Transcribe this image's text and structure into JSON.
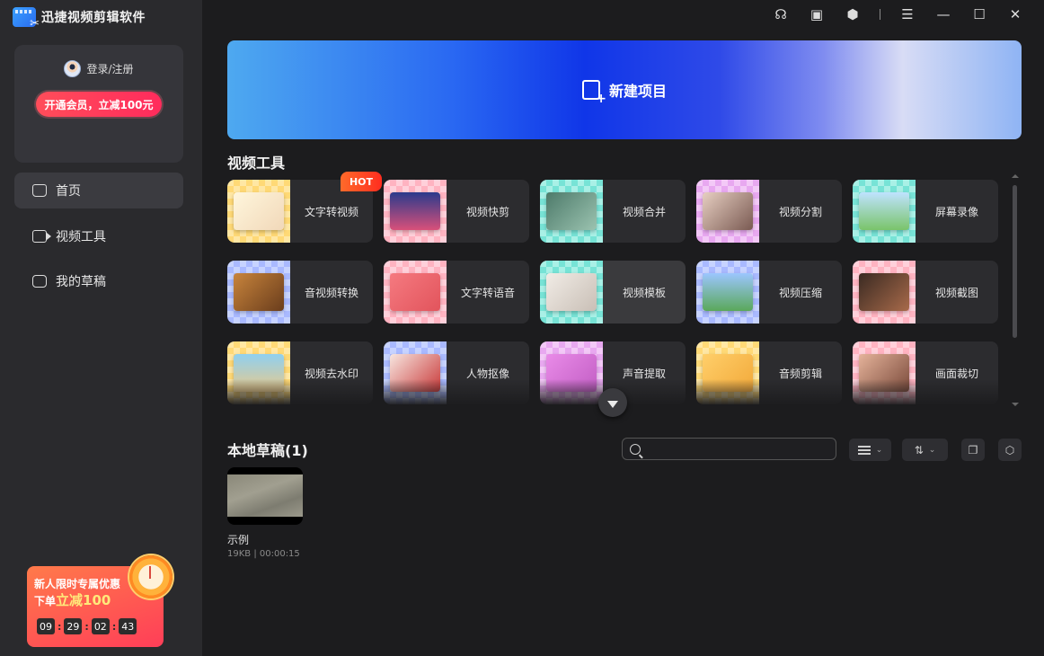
{
  "app": {
    "title": "迅捷视频剪辑软件"
  },
  "user": {
    "login_label": "登录/注册",
    "vip_button": "开通会员，立减100元"
  },
  "nav": [
    {
      "label": "首页",
      "icon": "home-icon",
      "active": true
    },
    {
      "label": "视频工具",
      "icon": "video-camera-icon",
      "active": false
    },
    {
      "label": "我的草稿",
      "icon": "drafts-icon",
      "active": false
    }
  ],
  "promo": {
    "line1": "新人限时专属优惠",
    "line2_prefix": "下单",
    "line2_highlight": "立减",
    "line2_amount": "100",
    "timer": [
      "09",
      "29",
      "02",
      "43"
    ]
  },
  "banner": {
    "label": "新建项目"
  },
  "tools_section": {
    "title": "视频工具",
    "hot_badge": "HOT"
  },
  "tools": [
    {
      "label": "文字转视频",
      "theme": "yellow"
    },
    {
      "label": "视频快剪",
      "theme": "pink"
    },
    {
      "label": "视频合并",
      "theme": "teal"
    },
    {
      "label": "视频分割",
      "theme": "violet"
    },
    {
      "label": "屏幕录像",
      "theme": "teal"
    },
    {
      "label": "音视频转换",
      "theme": "blue"
    },
    {
      "label": "文字转语音",
      "theme": "pink"
    },
    {
      "label": "视频模板",
      "theme": "teal"
    },
    {
      "label": "视频压缩",
      "theme": "blue"
    },
    {
      "label": "视频截图",
      "theme": "pink"
    },
    {
      "label": "视频去水印",
      "theme": "yellow"
    },
    {
      "label": "人物抠像",
      "theme": "blue"
    },
    {
      "label": "声音提取",
      "theme": "violet"
    },
    {
      "label": "音频剪辑",
      "theme": "yellow"
    },
    {
      "label": "画面裁切",
      "theme": "pink"
    }
  ],
  "drafts": {
    "title": "本地草稿(1)",
    "search_placeholder": "",
    "items": [
      {
        "name": "示例",
        "meta": "19KB | 00:00:15"
      }
    ]
  },
  "colors": {
    "accent_blue": "#1036e8",
    "vip_red": "#ff2b5c",
    "hot_orange": "#ff4a24"
  }
}
